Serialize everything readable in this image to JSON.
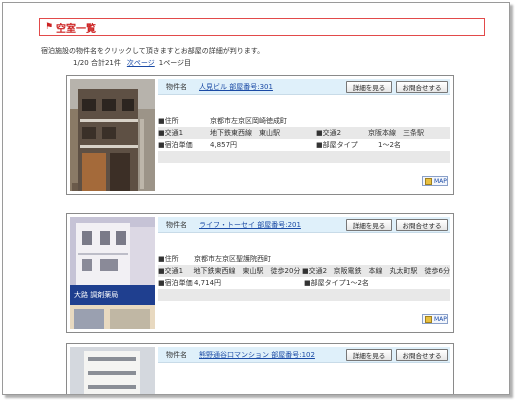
{
  "page": {
    "title": "空室一覧",
    "intro": "宿泊施設の物件名をクリックして頂きますとお部屋の詳細が判ります。",
    "pager": {
      "count": "1/20 合計21件",
      "next_label": "次ページ",
      "page": "1ページ目"
    }
  },
  "labels": {
    "name": "物件名",
    "detail_button": "詳細を見る",
    "inquiry_button": "お問合せする",
    "map": "MAP"
  },
  "listings": [
    {
      "name": "人見ビル 部屋番号:301",
      "address_label": "■住所",
      "address": "京都市左京区岡崎徳成町",
      "transit1_label": "■交通1",
      "transit1": "地下鉄東西線　東山駅",
      "transit2_label": "■交通2",
      "transit2": "京阪本線　三条駅",
      "price_label": "■宿泊単価",
      "price": "4,857円",
      "room_type_label": "■部屋タイプ",
      "room_type": "1〜2名"
    },
    {
      "name": "ライフ・トーセイ 部屋番号:201",
      "address_label": "■住所",
      "address": "京都市左京区聖護院西町",
      "transit1_label": "■交通1",
      "transit1": "地下鉄東西線　東山駅　徒歩20分",
      "transit2_label": "■交通2",
      "transit2": "京阪電鉄　本線　丸太町駅　徒歩6分",
      "price_label": "■宿泊単価",
      "price": "4,714円",
      "room_type_label": "■部屋タイプ",
      "room_type": "1〜2名"
    },
    {
      "name": "熊野通谷口マンション 部屋番号:102"
    }
  ],
  "photo_signage": "大路 調剤薬局"
}
